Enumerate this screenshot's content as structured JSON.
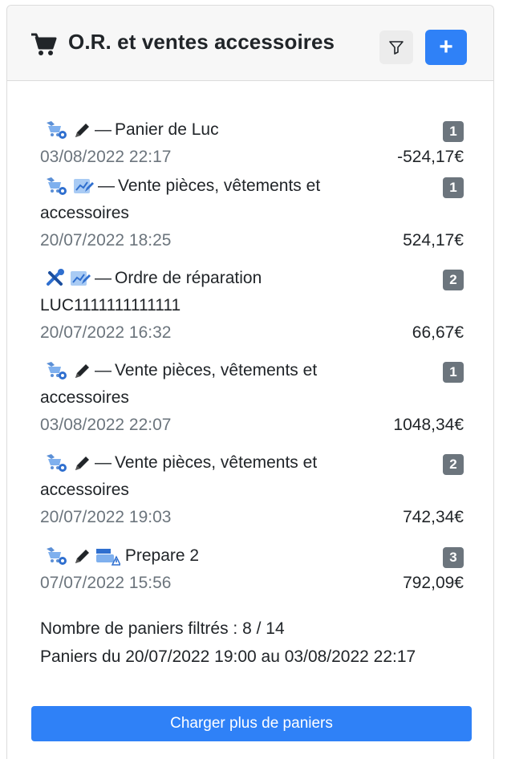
{
  "header": {
    "title": "O.R. et ventes accessoires",
    "add_label": "+"
  },
  "baskets": [
    {
      "icons": [
        "shop-cart-gear-icon",
        "pencil-icon"
      ],
      "title": "Panier de Luc",
      "title_cont": "",
      "badge": "1",
      "date": "03/08/2022 22:17",
      "amount": "-524,17€"
    },
    {
      "icons": [
        "shop-cart-gear-icon",
        "chart-edit-icon"
      ],
      "title": "Vente pièces, vêtements et",
      "title_cont": "accessoires",
      "badge": "1",
      "date": "20/07/2022 18:25",
      "amount": "524,17€"
    },
    {
      "icons": [
        "wrench-screwdriver-icon",
        "chart-edit-icon"
      ],
      "title": "Ordre de réparation",
      "title_cont": "LUC1111111111111",
      "badge": "2",
      "date": "20/07/2022 16:32",
      "amount": "66,67€"
    },
    {
      "icons": [
        "shop-cart-gear-icon",
        "pencil-icon"
      ],
      "title": "Vente pièces, vêtements et",
      "title_cont": "accessoires",
      "badge": "1",
      "date": "03/08/2022 22:07",
      "amount": "1048,34€"
    },
    {
      "icons": [
        "shop-cart-gear-icon",
        "pencil-icon"
      ],
      "title": "Vente pièces, vêtements et",
      "title_cont": "accessoires",
      "badge": "2",
      "date": "20/07/2022 19:03",
      "amount": "742,34€"
    },
    {
      "icons": [
        "shop-cart-gear-icon",
        "pencil-icon",
        "cash-register-warning-icon"
      ],
      "title": "Prepare 2",
      "title_cont": "",
      "badge": "3",
      "date": "07/07/2022 15:56",
      "amount": "792,09€"
    }
  ],
  "dash": "—",
  "summary": {
    "count_text": "Nombre de paniers filtrés : 8 / 14",
    "range_text": "Paniers du 20/07/2022 19:00 au 03/08/2022 22:17"
  },
  "load_more_label": "Charger plus de paniers",
  "colors": {
    "primary": "#2f81f7",
    "badge": "#6c757d",
    "muted": "#6c757d"
  }
}
